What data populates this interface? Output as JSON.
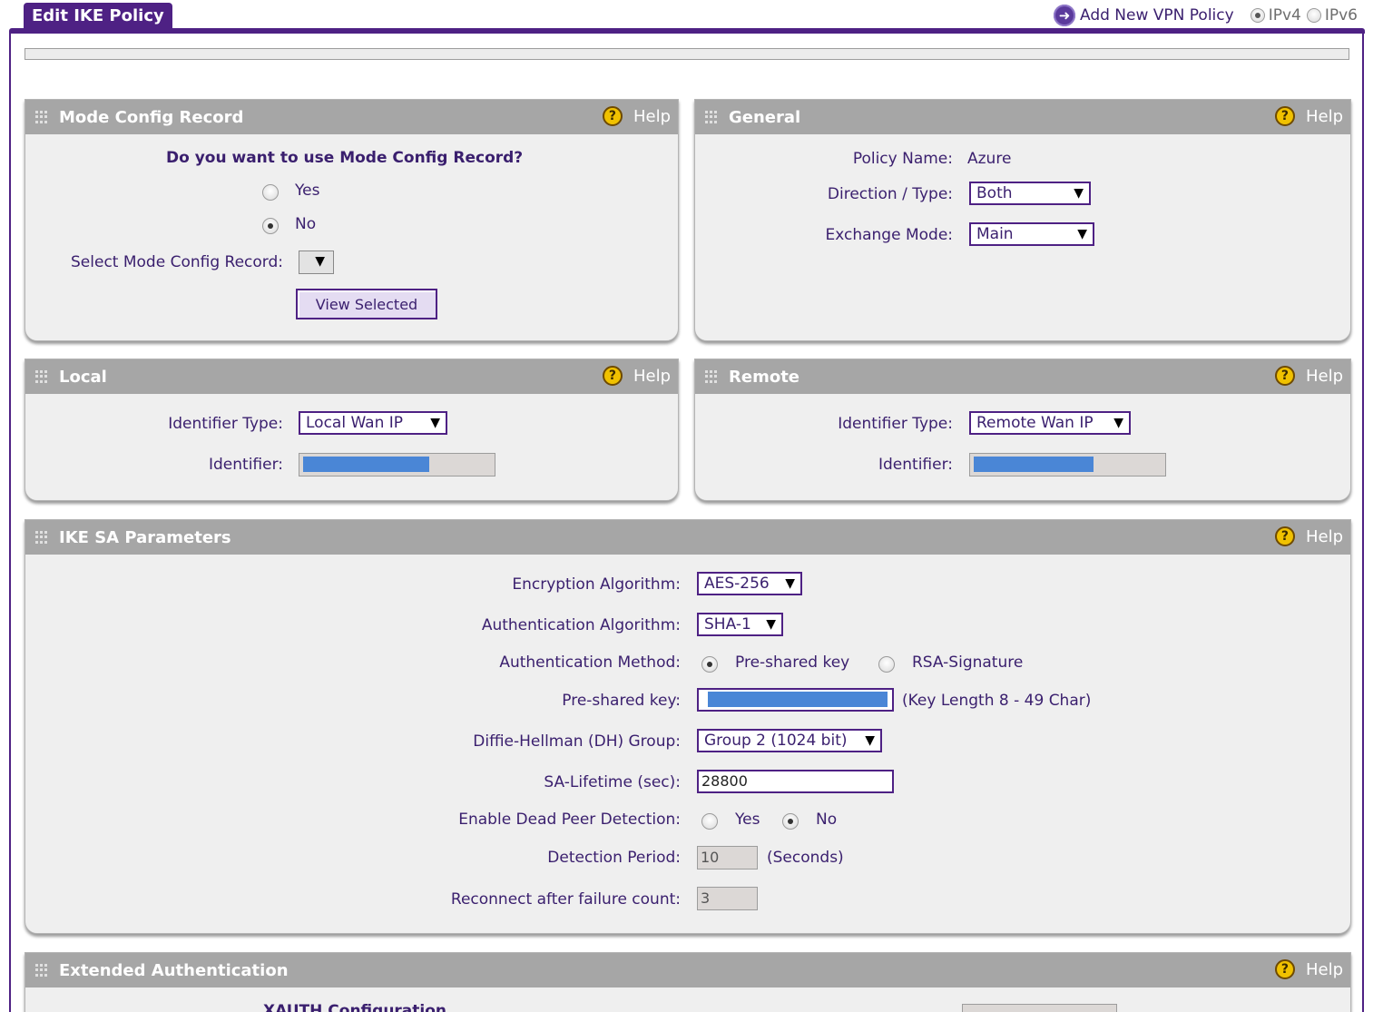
{
  "page": {
    "title": "Edit IKE Policy",
    "add_new_label": "Add New VPN Policy",
    "ipv4_label": "IPv4",
    "ipv6_label": "IPv6"
  },
  "help_label": "Help",
  "mode_config": {
    "title": "Mode Config Record",
    "question": "Do you want to use Mode Config Record?",
    "yes_label": "Yes",
    "no_label": "No",
    "selected": "No",
    "select_label": "Select Mode Config Record:",
    "select_value": "",
    "view_button": "View Selected"
  },
  "general": {
    "title": "General",
    "policy_name_label": "Policy Name:",
    "policy_name_value": "Azure",
    "direction_label": "Direction / Type:",
    "direction_value": "Both",
    "exchange_label": "Exchange Mode:",
    "exchange_value": "Main"
  },
  "local": {
    "title": "Local",
    "id_type_label": "Identifier Type:",
    "id_type_value": "Local Wan IP",
    "identifier_label": "Identifier:"
  },
  "remote": {
    "title": "Remote",
    "id_type_label": "Identifier Type:",
    "id_type_value": "Remote Wan IP",
    "identifier_label": "Identifier:"
  },
  "ike_sa": {
    "title": "IKE SA Parameters",
    "encryption_label": "Encryption Algorithm:",
    "encryption_value": "AES-256",
    "auth_algo_label": "Authentication Algorithm:",
    "auth_algo_value": "SHA-1",
    "auth_method_label": "Authentication Method:",
    "auth_method_psk": "Pre-shared key",
    "auth_method_rsa": "RSA-Signature",
    "auth_method_selected": "Pre-shared key",
    "psk_label": "Pre-shared key:",
    "psk_hint": "(Key Length 8 - 49 Char)",
    "dh_label": "Diffie-Hellman (DH) Group:",
    "dh_value": "Group 2 (1024 bit)",
    "lifetime_label": "SA-Lifetime (sec):",
    "lifetime_value": "28800",
    "dpd_label": "Enable Dead Peer Detection:",
    "dpd_yes": "Yes",
    "dpd_no": "No",
    "dpd_selected": "No",
    "detection_label": "Detection Period:",
    "detection_value": "10",
    "detection_unit": "(Seconds)",
    "reconnect_label": "Reconnect after failure count:",
    "reconnect_value": "3"
  },
  "xauth": {
    "title": "Extended Authentication",
    "sub_heading": "XAUTH Configuration"
  },
  "colors": {
    "brand_purple": "#4e2184",
    "panel_header": "#a6a6a6",
    "panel_body": "#efefef",
    "redaction_blue": "#4a86d6",
    "help_yellow": "#f0c100"
  }
}
